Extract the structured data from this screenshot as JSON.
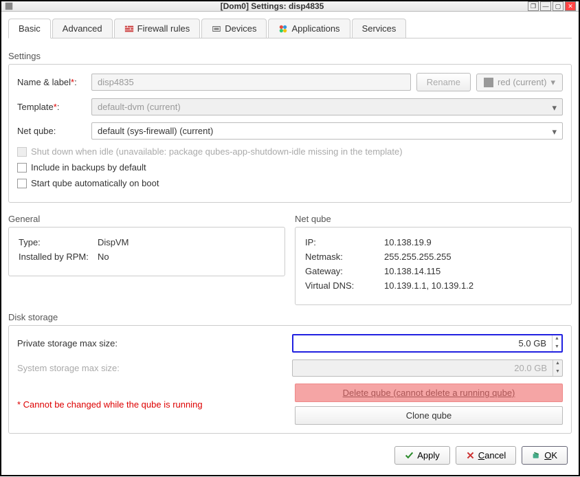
{
  "window": {
    "title": "[Dom0] Settings: disp4835"
  },
  "tabs": {
    "basic": "Basic",
    "advanced": "Advanced",
    "firewall": "Firewall rules",
    "devices": "Devices",
    "applications": "Applications",
    "services": "Services"
  },
  "sections": {
    "settings": "Settings",
    "general": "General",
    "netqube": "Net qube",
    "disk": "Disk storage"
  },
  "form": {
    "name_label_lbl": "Name & label",
    "name_value": "disp4835",
    "rename_btn": "Rename",
    "color_label": "red (current)",
    "template_lbl": "Template",
    "template_value": "default-dvm (current)",
    "netqube_lbl": "Net qube:",
    "netqube_value": "default (sys-firewall) (current)",
    "shutdown_idle": "Shut down when idle (unavailable: package qubes-app-shutdown-idle missing in the template)",
    "include_backups": "Include in backups by default",
    "autostart": "Start qube automatically on boot"
  },
  "general": {
    "type_lbl": "Type:",
    "type_val": "DispVM",
    "rpm_lbl": "Installed by RPM:",
    "rpm_val": "No"
  },
  "netinfo": {
    "ip_lbl": "IP:",
    "ip_val": "10.138.19.9",
    "netmask_lbl": "Netmask:",
    "netmask_val": "255.255.255.255",
    "gateway_lbl": "Gateway:",
    "gateway_val": "10.138.14.115",
    "dns_lbl": "Virtual DNS:",
    "dns_val": "10.139.1.1, 10.139.1.2"
  },
  "storage": {
    "private_lbl": "Private storage max size:",
    "private_val": "5.0 GB",
    "system_lbl": "System storage max size:",
    "system_val": "20.0 GB"
  },
  "footer": {
    "warning": "* Cannot be changed while the qube is running",
    "delete_btn": "Delete qube (cannot delete a running qube)",
    "clone_btn": "Clone qube"
  },
  "buttons": {
    "apply": "Apply",
    "cancel": "Cancel",
    "ok": "OK"
  }
}
